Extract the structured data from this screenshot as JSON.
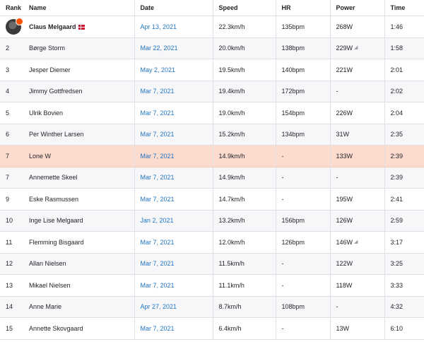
{
  "header": {
    "rank": "Rank",
    "name": "Name",
    "date": "Date",
    "speed": "Speed",
    "hr": "HR",
    "power": "Power",
    "time": "Time"
  },
  "rows": [
    {
      "rank": "",
      "name": "Claus Melgaard",
      "date": "Apr 13, 2021",
      "speed": "22.3km/h",
      "hr": "135bpm",
      "power": "268W",
      "time": "1:46",
      "leader": true,
      "avatar": "athlete-avatar",
      "flag": "denmark-flag-icon"
    },
    {
      "rank": "2",
      "name": "Børge Storm",
      "date": "Mar 22, 2021",
      "speed": "20.0km/h",
      "hr": "138bpm",
      "power": "229W",
      "time": "1:58",
      "estimated_power": true
    },
    {
      "rank": "3",
      "name": "Jesper Diemer",
      "date": "May 2, 2021",
      "speed": "19.5km/h",
      "hr": "140bpm",
      "power": "221W",
      "time": "2:01"
    },
    {
      "rank": "4",
      "name": "Jimmy Gottfredsen",
      "date": "Mar 7, 2021",
      "speed": "19.4km/h",
      "hr": "172bpm",
      "power": "-",
      "time": "2:02"
    },
    {
      "rank": "5",
      "name": "Ulrik Bovien",
      "date": "Mar 7, 2021",
      "speed": "19.0km/h",
      "hr": "154bpm",
      "power": "226W",
      "time": "2:04"
    },
    {
      "rank": "6",
      "name": "Per Winther Larsen",
      "date": "Mar 7, 2021",
      "speed": "15.2km/h",
      "hr": "134bpm",
      "power": "31W",
      "time": "2:35"
    },
    {
      "rank": "7",
      "name": "Lone W",
      "date": "Mar 7, 2021",
      "speed": "14.9km/h",
      "hr": "-",
      "power": "133W",
      "time": "2:39",
      "highlight": true
    },
    {
      "rank": "7",
      "name": "Annemette Skeel",
      "date": "Mar 7, 2021",
      "speed": "14.9km/h",
      "hr": "-",
      "power": "-",
      "time": "2:39"
    },
    {
      "rank": "9",
      "name": "Eske Rasmussen",
      "date": "Mar 7, 2021",
      "speed": "14.7km/h",
      "hr": "-",
      "power": "195W",
      "time": "2:41"
    },
    {
      "rank": "10",
      "name": "Inge Lise Melgaard",
      "date": "Jan 2, 2021",
      "speed": "13.2km/h",
      "hr": "156bpm",
      "power": "126W",
      "time": "2:59"
    },
    {
      "rank": "11",
      "name": "Flemming Bisgaard",
      "date": "Mar 7, 2021",
      "speed": "12.0km/h",
      "hr": "126bpm",
      "power": "146W",
      "time": "3:17",
      "estimated_power": true
    },
    {
      "rank": "12",
      "name": "Allan Nielsen",
      "date": "Mar 7, 2021",
      "speed": "11.5km/h",
      "hr": "-",
      "power": "122W",
      "time": "3:25"
    },
    {
      "rank": "13",
      "name": "Mikael Nielsen",
      "date": "Mar 7, 2021",
      "speed": "11.1km/h",
      "hr": "-",
      "power": "118W",
      "time": "3:33"
    },
    {
      "rank": "14",
      "name": "Anne Marie",
      "date": "Apr 27, 2021",
      "speed": "8.7km/h",
      "hr": "108bpm",
      "power": "-",
      "time": "4:32"
    },
    {
      "rank": "15",
      "name": "Annette Skovgaard",
      "date": "Mar 7, 2021",
      "speed": "6.4km/h",
      "hr": "-",
      "power": "13W",
      "time": "6:10"
    }
  ],
  "colors": {
    "link": "#1f75c2",
    "highlight_row": "#fddbcf",
    "brand": "#fc5200"
  }
}
